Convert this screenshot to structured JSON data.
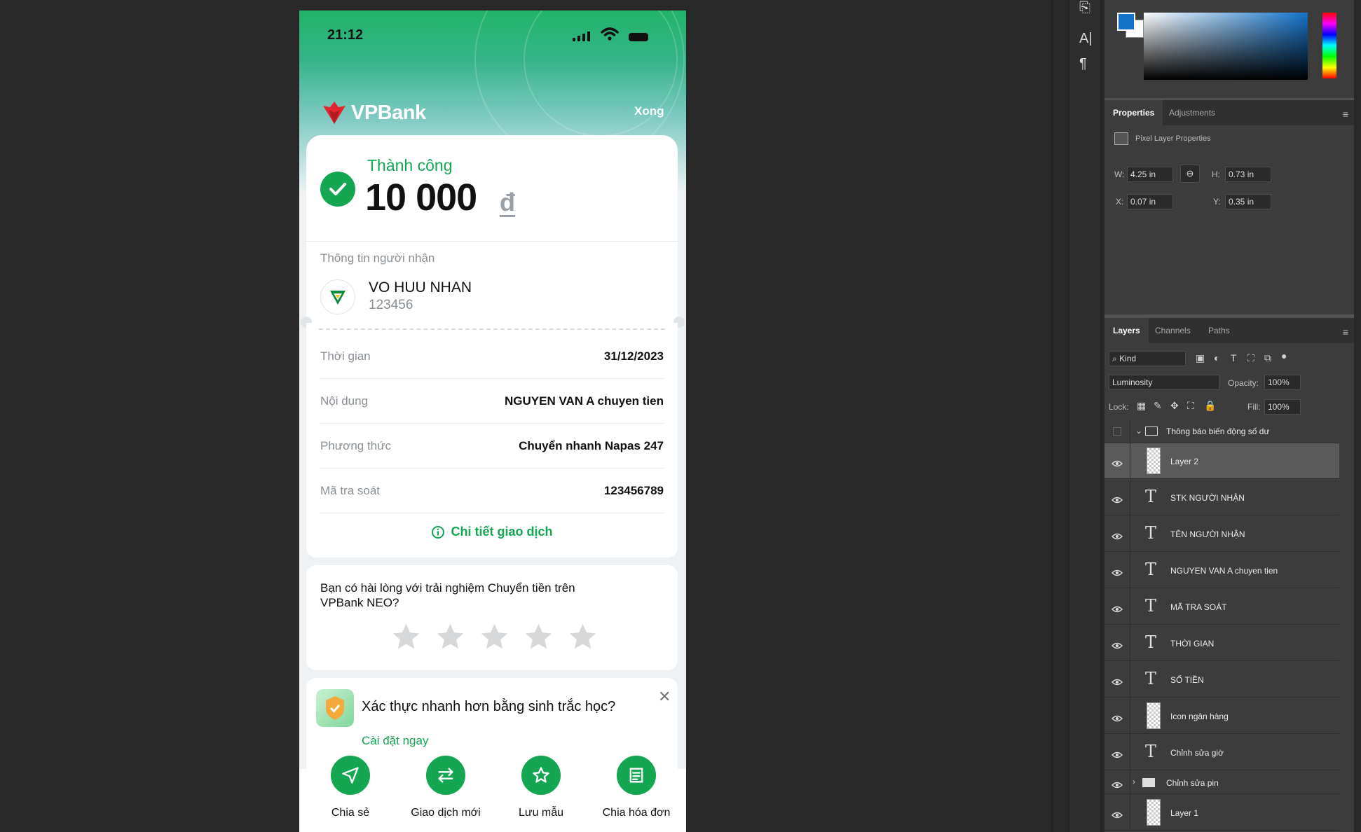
{
  "phone": {
    "status_time": "21:12",
    "brand": "VPBank",
    "done_label": "Xong",
    "success_label": "Thành công",
    "amount": "10 000",
    "currency": "đ",
    "recipient_title": "Thông tin người nhận",
    "recipient_name": "VO HUU NHAN",
    "recipient_account": "123456",
    "details": [
      {
        "label": "Thời gian",
        "value": "31/12/2023"
      },
      {
        "label": "Nội dung",
        "value": "NGUYEN VAN A chuyen tien"
      },
      {
        "label": "Phương thức",
        "value": "Chuyển nhanh Napas 247"
      },
      {
        "label": "Mã tra soát",
        "value": "123456789"
      }
    ],
    "detail_link": "Chi tiết giao dịch",
    "survey_question": "Bạn có hài lòng với trải nghiệm Chuyển tiền trên VPBank NEO?",
    "rating": 0,
    "rating_max": 5,
    "biometric_text": "Xác thực nhanh hơn bằng sinh trắc học?",
    "biometric_setup": "Cài đặt ngay",
    "actions": [
      {
        "label": "Chia sẻ",
        "icon": "send-icon"
      },
      {
        "label": "Giao dịch mới",
        "icon": "transfer-icon"
      },
      {
        "label": "Lưu mẫu",
        "icon": "star-icon"
      },
      {
        "label": "Chia hóa đơn",
        "icon": "bill-icon"
      }
    ],
    "accent_color": "#14a651"
  },
  "properties_panel": {
    "tabs": [
      "Properties",
      "Adjustments"
    ],
    "active_tab": "Properties",
    "subtitle": "Pixel Layer Properties",
    "w_label": "W:",
    "w": "4.25 in",
    "h_label": "H:",
    "h": "0.73 in",
    "x_label": "X:",
    "x": "0.07 in",
    "y_label": "Y:",
    "y": "0.35 in"
  },
  "layers_panel": {
    "tabs": [
      "Layers",
      "Channels",
      "Paths"
    ],
    "active_tab": "Layers",
    "filter": "Kind",
    "blend_mode": "Luminosity",
    "opacity_label": "Opacity:",
    "opacity": "100%",
    "lock_label": "Lock:",
    "fill_label": "Fill:",
    "fill": "100%",
    "group_name": "Thông báo biến động số dư",
    "layers": [
      {
        "name": "Layer 2",
        "type": "pixel",
        "selected": true
      },
      {
        "name": "STK NGƯỜI NHẬN",
        "type": "text"
      },
      {
        "name": "TÊN NGƯỜI NHẬN",
        "type": "text"
      },
      {
        "name": "NGUYEN VAN A chuyen tien",
        "type": "text"
      },
      {
        "name": "MÃ TRA SOÁT",
        "type": "text"
      },
      {
        "name": "THỜI GIAN",
        "type": "text"
      },
      {
        "name": "SỐ TIỀN",
        "type": "text"
      },
      {
        "name": "Icon ngân hàng",
        "type": "smart"
      },
      {
        "name": "Chỉnh sửa giờ",
        "type": "text"
      },
      {
        "name": "Chỉnh sửa pin",
        "type": "group"
      },
      {
        "name": "Layer 1",
        "type": "pixel"
      }
    ]
  },
  "colors": {
    "foreground": "#1473c9",
    "background": "#ffffff"
  }
}
